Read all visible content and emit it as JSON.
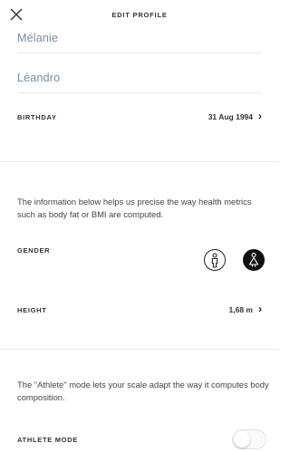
{
  "header": {
    "title": "EDIT PROFILE",
    "close_icon": "close-icon"
  },
  "profile": {
    "first_name": "Mélanie",
    "last_name": "Léandro",
    "birthday_label": "BIRTHDAY",
    "birthday_value": "31 Aug 1994"
  },
  "metrics": {
    "info_text": "The information below helps us precise the way health metrics such as body fat or BMI are computed.",
    "gender_label": "GENDER",
    "gender_options": [
      {
        "name": "male",
        "icon": "male-icon",
        "selected": false
      },
      {
        "name": "female",
        "icon": "female-icon",
        "selected": true
      }
    ],
    "height_label": "HEIGHT",
    "height_value": "1,68 m"
  },
  "athlete": {
    "info_text": "The \"Athlete\" mode lets your scale adapt the way it computes body composition.",
    "label": "ATHLETE MODE",
    "enabled": false
  },
  "colors": {
    "name_text": "#6f8fb0",
    "selected_gender_bg": "#111111"
  }
}
